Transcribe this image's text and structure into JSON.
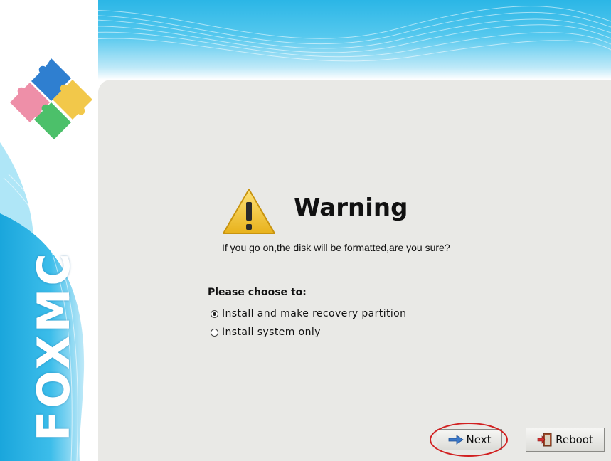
{
  "brand": {
    "name": "FOXMC",
    "logo": "puzzle-pieces-logo"
  },
  "dialog": {
    "icon": "warning-icon",
    "title": "Warning",
    "message": "If you go on,the disk will be formatted,are you sure?",
    "choose_label": "Please choose to:",
    "options": [
      {
        "label": "Install and make recovery partition",
        "selected": true
      },
      {
        "label": "Install system only",
        "selected": false
      }
    ]
  },
  "buttons": {
    "next_label": "Next",
    "next_icon": "arrow-right-icon",
    "reboot_label": "Reboot",
    "reboot_icon": "exit-door-icon"
  },
  "annotation": {
    "highlight_color": "#d12020",
    "highlight_target": "next-button"
  },
  "colors": {
    "accent_blue": "#2bb6e6",
    "panel_bg": "#e9e9e6"
  }
}
